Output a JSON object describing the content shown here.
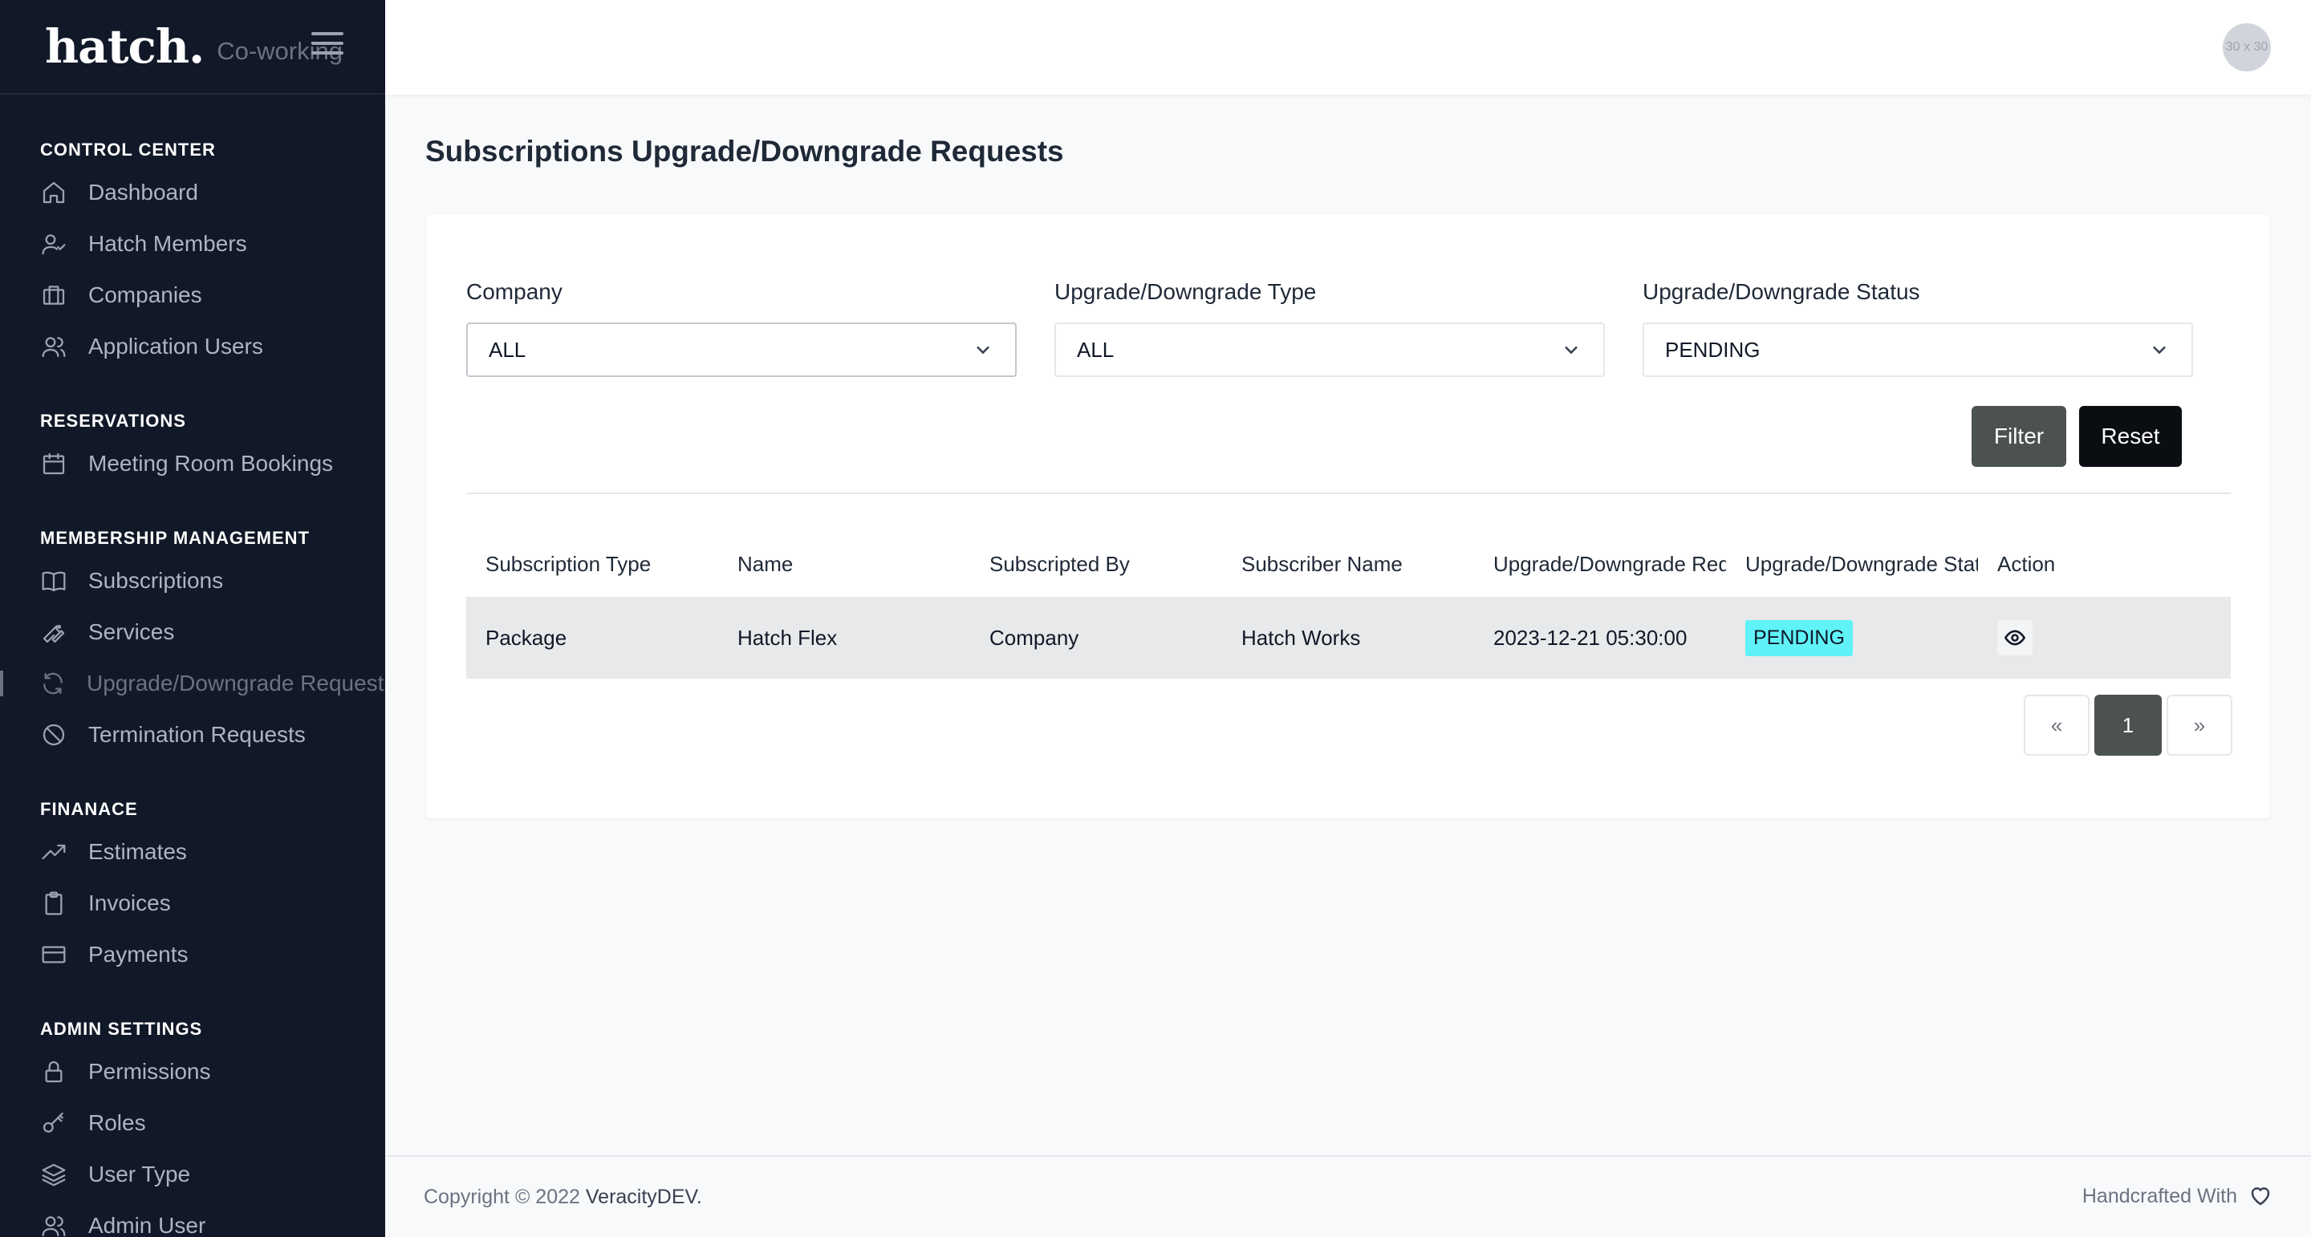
{
  "brand": {
    "logo": "hatch.",
    "subtitle": "Co-working"
  },
  "sidebar": {
    "sections": [
      {
        "heading": "CONTROL CENTER",
        "items": [
          {
            "label": "Dashboard",
            "icon": "home-icon"
          },
          {
            "label": "Hatch Members",
            "icon": "user-check-icon"
          },
          {
            "label": "Companies",
            "icon": "briefcase-icon"
          },
          {
            "label": "Application Users",
            "icon": "users-icon"
          }
        ]
      },
      {
        "heading": "RESERVATIONS",
        "items": [
          {
            "label": "Meeting Room Bookings",
            "icon": "calendar-icon"
          }
        ]
      },
      {
        "heading": "MEMBERSHIP MANAGEMENT",
        "items": [
          {
            "label": "Subscriptions",
            "icon": "book-icon"
          },
          {
            "label": "Services",
            "icon": "wrench-icon"
          },
          {
            "label": "Upgrade/Downgrade Requests",
            "icon": "refresh-icon",
            "active": true
          },
          {
            "label": "Termination Requests",
            "icon": "ban-icon"
          }
        ]
      },
      {
        "heading": "FINANACE",
        "items": [
          {
            "label": "Estimates",
            "icon": "trending-up-icon"
          },
          {
            "label": "Invoices",
            "icon": "clipboard-icon"
          },
          {
            "label": "Payments",
            "icon": "credit-card-icon"
          }
        ]
      },
      {
        "heading": "ADMIN SETTINGS",
        "items": [
          {
            "label": "Permissions",
            "icon": "lock-icon"
          },
          {
            "label": "Roles",
            "icon": "key-icon"
          },
          {
            "label": "User Type",
            "icon": "layers-icon"
          },
          {
            "label": "Admin User",
            "icon": "users-icon"
          }
        ]
      }
    ]
  },
  "header": {
    "avatar_text": "30 x 30"
  },
  "main": {
    "title": "Subscriptions Upgrade/Downgrade Requests",
    "filters": {
      "company": {
        "label": "Company",
        "value": "ALL"
      },
      "type": {
        "label": "Upgrade/Downgrade Type",
        "value": "ALL"
      },
      "status": {
        "label": "Upgrade/Downgrade Status",
        "value": "PENDING"
      }
    },
    "buttons": {
      "filter": "Filter",
      "reset": "Reset"
    },
    "table": {
      "columns": [
        "Subscription Type",
        "Name",
        "Subscripted By",
        "Subscriber Name",
        "Upgrade/Downgrade Requested",
        "Upgrade/Downgrade Status",
        "Action"
      ],
      "rows": [
        {
          "subscription_type": "Package",
          "name": "Hatch Flex",
          "subscripted_by": "Company",
          "subscriber_name": "Hatch Works",
          "requested": "2023-12-21 05:30:00",
          "status": "PENDING"
        }
      ]
    },
    "pagination": {
      "prev": "«",
      "current": "1",
      "next": "»"
    }
  },
  "footer": {
    "copyright": "Copyright © 2022",
    "company": "VeracityDEV.",
    "handcrafted": "Handcrafted With"
  },
  "colors": {
    "sidebar_bg": "#111827",
    "status_badge": "#5ff3f7",
    "primary_btn": "#4b524f",
    "dark_btn": "#0a0d12"
  }
}
